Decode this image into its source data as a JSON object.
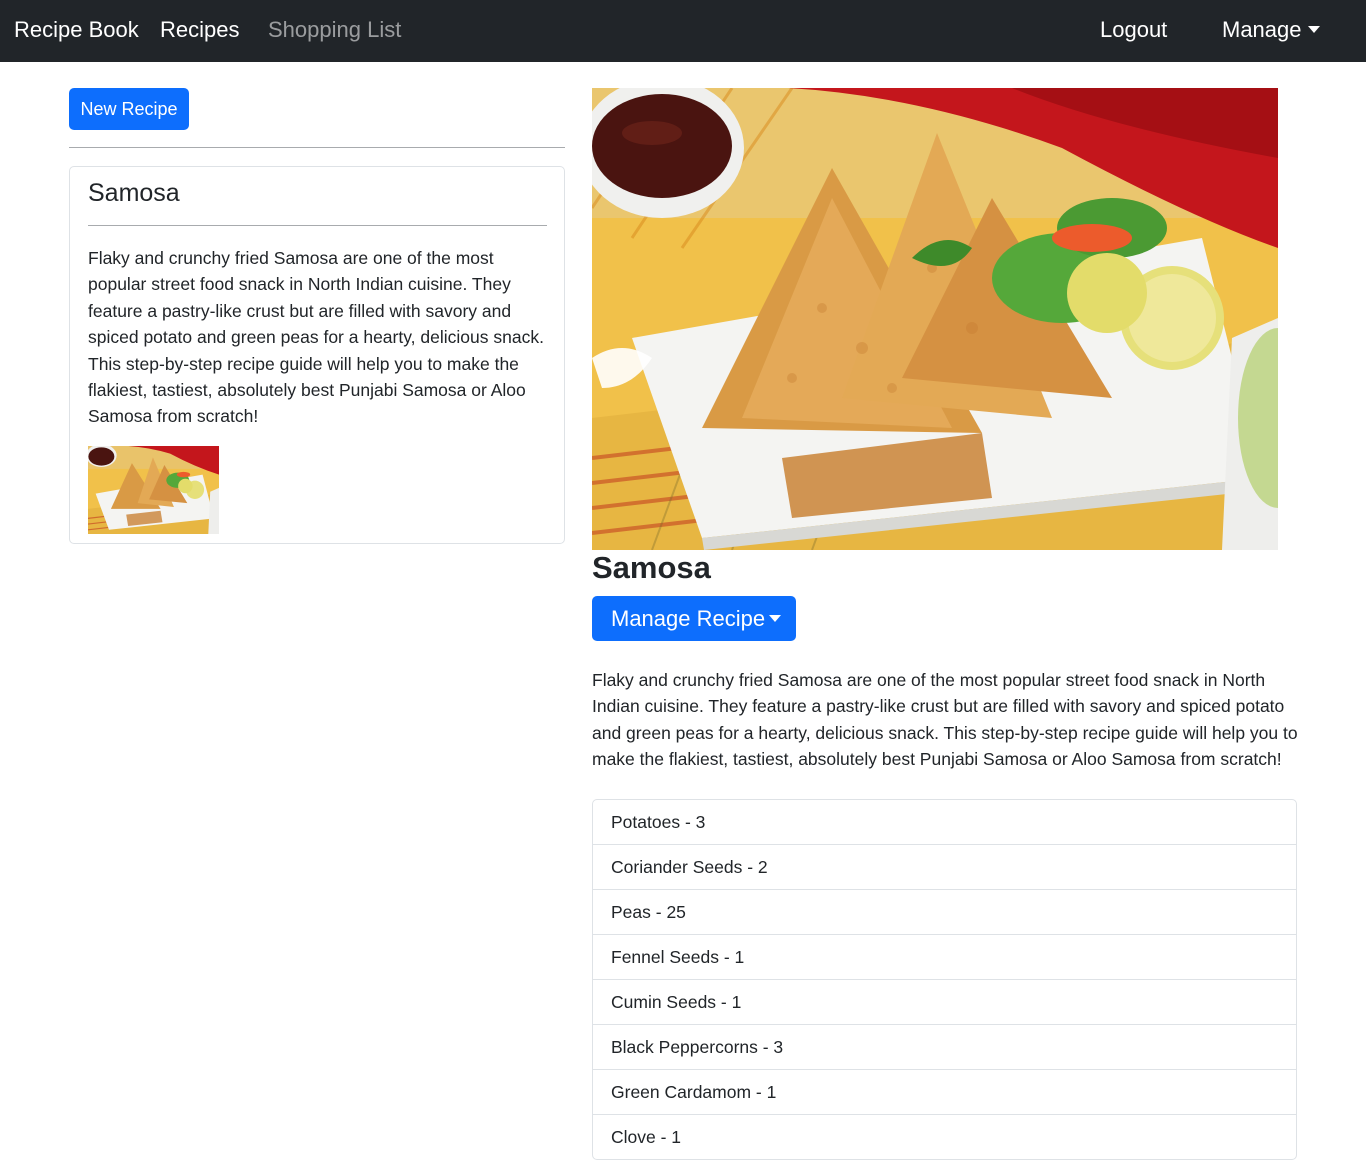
{
  "navbar": {
    "brand": "Recipe Book",
    "recipes": "Recipes",
    "shopping_list": "Shopping List",
    "logout": "Logout",
    "manage": "Manage"
  },
  "sidebar": {
    "new_recipe": "New Recipe",
    "card": {
      "title": "Samosa",
      "description": "Flaky and crunchy fried Samosa are one of the most popular street food snack in North Indian cuisine. They feature a pastry-like crust but are filled with savory and spiced potato and green peas for a hearty, delicious snack. This step-by-step recipe guide will help you to make the flakiest, tastiest, absolutely best Punjabi Samosa or Aloo Samosa from scratch!"
    }
  },
  "detail": {
    "title": "Samosa",
    "manage_recipe": "Manage Recipe",
    "description": "Flaky and crunchy fried Samosa are one of the most popular street food snack in North Indian cuisine. They feature a pastry-like crust but are filled with savory and spiced potato and green peas for a hearty, delicious snack. This step-by-step recipe guide will help you to make the flakiest, tastiest, absolutely best Punjabi Samosa or Aloo Samosa from scratch!",
    "ingredients": [
      "Potatoes - 3",
      "Coriander Seeds - 2",
      "Peas - 25",
      "Fennel Seeds - 1",
      "Cumin Seeds - 1",
      "Black Peppercorns - 3",
      "Green Cardamom - 1",
      "Clove - 1"
    ]
  },
  "colors": {
    "navbar_bg": "#212529",
    "primary": "#0d6efd"
  },
  "icons": [
    "caret-down-icon"
  ]
}
